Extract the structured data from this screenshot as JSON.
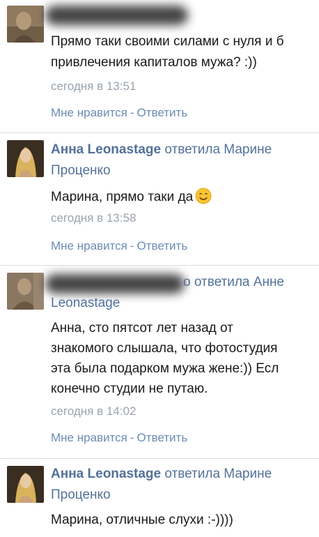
{
  "comments": [
    {
      "text_lines": [
        "Прямо таки своими силами с нуля и б",
        "привлечения капиталов мужа? :))"
      ],
      "time": "сегодня в 13:51",
      "like": "Мне нравится",
      "sep": "-",
      "reply": "Ответить"
    },
    {
      "author": "Анна Leonastage",
      "replied": "ответила Марине",
      "replied_cont": "Проценко",
      "text_lines": [
        "Марина, прямо таки да"
      ],
      "emoji": "smile-emoji",
      "time": "сегодня в 13:58",
      "like": "Мне нравится",
      "sep": "-",
      "reply": "Ответить"
    },
    {
      "replied_tail": "о",
      "replied": "ответила Анне",
      "replied_cont": "Leonastage",
      "text_lines": [
        "Анна, сто пятсот лет назад от",
        "знакомого слышала, что фотостудия",
        "эта была подарком мужа жене:)) Есл",
        "конечно студии не путаю."
      ],
      "time": "сегодня в 14:02",
      "like": "Мне нравится",
      "sep": "-",
      "reply": "Ответить"
    },
    {
      "author": "Анна Leonastage",
      "replied": "ответила Марине",
      "replied_cont": "Проценко",
      "text_lines": [
        "Марина, отличные слухи :-))))"
      ]
    }
  ],
  "colors": {
    "link": "#52719a",
    "meta": "#9aa3ad",
    "divider": "#d8dde5"
  }
}
